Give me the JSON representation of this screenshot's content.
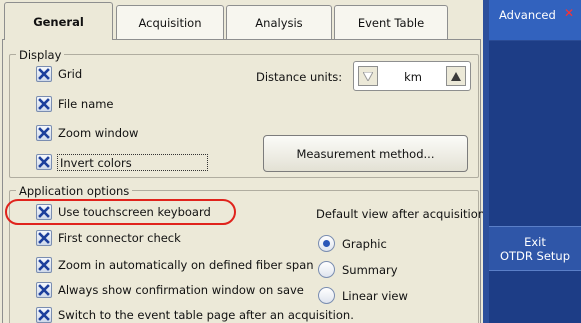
{
  "tabs": [
    {
      "label": "General",
      "active": true
    },
    {
      "label": "Acquisition",
      "active": false
    },
    {
      "label": "Analysis",
      "active": false
    },
    {
      "label": "Event Table",
      "active": false
    }
  ],
  "display": {
    "legend": "Display",
    "grid": {
      "label": "Grid",
      "checked": true
    },
    "file_name": {
      "label": "File name",
      "checked": true
    },
    "zoom_window": {
      "label": "Zoom window",
      "checked": true
    },
    "invert_colors": {
      "label": "Invert colors",
      "checked": true
    },
    "distance_units_label": "Distance units:",
    "distance_units_value": "km",
    "measurement_button": "Measurement method..."
  },
  "app_options": {
    "legend": "Application options",
    "touch_keyboard": {
      "label": "Use touchscreen keyboard",
      "checked": true
    },
    "connector_check": {
      "label": "First connector check",
      "checked": true
    },
    "zoom_auto": {
      "label": "Zoom in automatically on defined fiber span",
      "checked": true
    },
    "confirm_save": {
      "label": "Always show confirmation window on save",
      "checked": true
    },
    "switch_event": {
      "label": "Switch to the event table page after an acquisition.",
      "checked": true
    },
    "default_view_label": "Default view after acquisition",
    "views": [
      {
        "label": "Graphic",
        "selected": true
      },
      {
        "label": "Summary",
        "selected": false
      },
      {
        "label": "Linear view",
        "selected": false
      }
    ]
  },
  "side": {
    "tab_label": "Advanced",
    "exit_line1": "Exit",
    "exit_line2": "OTDR Setup"
  },
  "colors": {
    "highlight": "#e0231c",
    "side_panel": "#1d3d86",
    "check_mark": "#1c3f9c"
  }
}
